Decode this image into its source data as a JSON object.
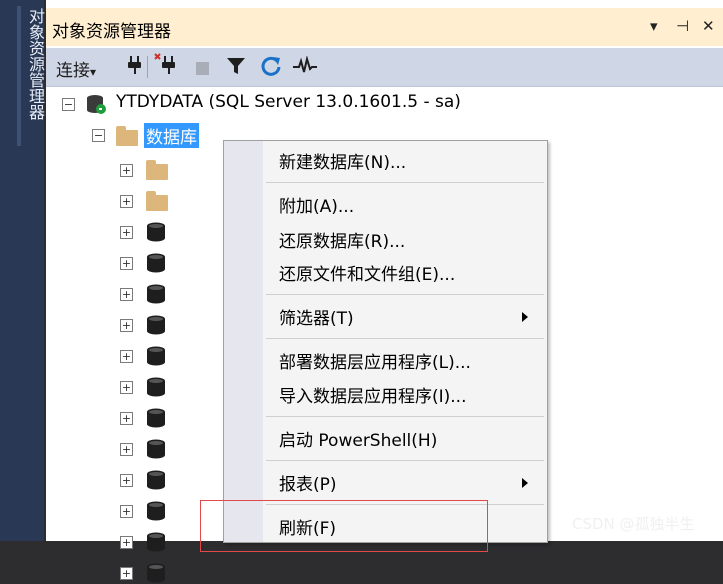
{
  "sidebar": {
    "vertical_tab_label": "对象资源管理器"
  },
  "panel": {
    "title": "对象资源管理器",
    "pin_icon": "⊣",
    "close_icon": "✕",
    "dropdown_icon": "▾"
  },
  "toolbar": {
    "connect_label": "连接",
    "connect_dropdown": "▾"
  },
  "tree": {
    "server_label": "YTDYDATA (SQL Server 13.0.1601.5 - sa)",
    "databases_label": "数据库",
    "children": [
      {
        "kind": "folder"
      },
      {
        "kind": "folder"
      },
      {
        "kind": "database"
      },
      {
        "kind": "database"
      },
      {
        "kind": "database"
      },
      {
        "kind": "database"
      },
      {
        "kind": "database"
      },
      {
        "kind": "database"
      },
      {
        "kind": "database"
      },
      {
        "kind": "database"
      },
      {
        "kind": "database"
      },
      {
        "kind": "database"
      },
      {
        "kind": "database"
      },
      {
        "kind": "database"
      }
    ]
  },
  "context_menu": {
    "items": [
      {
        "label": "新建数据库(N)..."
      },
      {
        "label": "附加(A)..."
      },
      {
        "label": "还原数据库(R)..."
      },
      {
        "label": "还原文件和文件组(E)..."
      },
      {
        "label": "筛选器(T)",
        "submenu": true
      },
      {
        "label": "部署数据层应用程序(L)..."
      },
      {
        "label": "导入数据层应用程序(I)..."
      },
      {
        "label": "启动 PowerShell(H)"
      },
      {
        "label": "报表(P)",
        "submenu": true
      },
      {
        "label": "刷新(F)"
      }
    ]
  },
  "watermark": "CSDN @孤独半生",
  "colors": {
    "accent_selection": "#3399ff",
    "highlight_box": "#e24a4a",
    "title_bar": "#ffeed0"
  }
}
